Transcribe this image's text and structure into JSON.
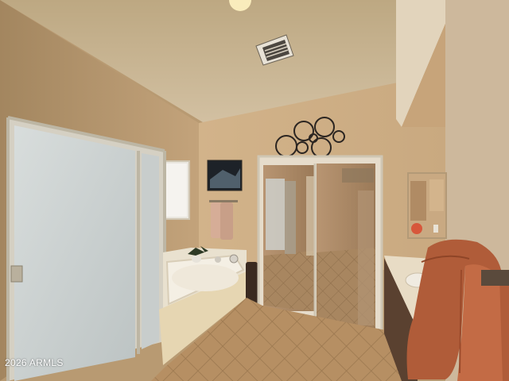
{
  "watermark": {
    "text": "2026 ARMLS"
  },
  "colors": {
    "wall": "#c8a77d",
    "ceiling": "#c6b191",
    "floor": "#b08a60",
    "towel": "#b8633f",
    "shower_glass": "#cfd5d5",
    "frame": "#d7d2c4",
    "tub": "#efe8d8"
  }
}
